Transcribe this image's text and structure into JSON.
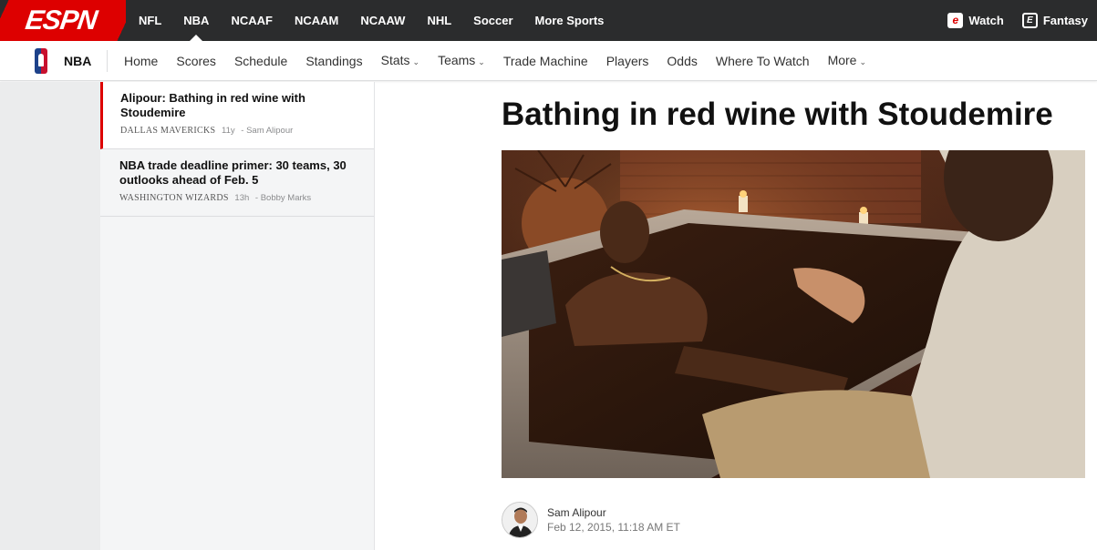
{
  "topbar": {
    "logo": "ESPN",
    "sports": [
      "NFL",
      "NBA",
      "NCAAF",
      "NCAAM",
      "NCAAW",
      "NHL",
      "Soccer",
      "More Sports"
    ],
    "active_sport": "NBA",
    "watch_label": "Watch",
    "fantasy_label": "Fantasy"
  },
  "subnav": {
    "league": "NBA",
    "links": [
      {
        "label": "Home",
        "dropdown": false
      },
      {
        "label": "Scores",
        "dropdown": false
      },
      {
        "label": "Schedule",
        "dropdown": false
      },
      {
        "label": "Standings",
        "dropdown": false
      },
      {
        "label": "Stats",
        "dropdown": true
      },
      {
        "label": "Teams",
        "dropdown": true
      },
      {
        "label": "Trade Machine",
        "dropdown": false
      },
      {
        "label": "Players",
        "dropdown": false
      },
      {
        "label": "Odds",
        "dropdown": false
      },
      {
        "label": "Where To Watch",
        "dropdown": false
      },
      {
        "label": "More",
        "dropdown": true
      }
    ]
  },
  "sidebar": {
    "stories": [
      {
        "headline": "Alipour: Bathing in red wine with Stoudemire",
        "team": "DALLAS MAVERICKS",
        "time": "11y",
        "author": "- Sam Alipour"
      },
      {
        "headline": "NBA trade deadline primer: 30 teams, 30 outlooks ahead of Feb. 5",
        "team": "WASHINGTON WIZARDS",
        "time": "13h",
        "author": "- Bobby Marks"
      }
    ]
  },
  "article": {
    "headline": "Bathing in red wine with Stoudemire",
    "author": "Sam Alipour",
    "date": "Feb 12, 2015, 11:18 AM ET"
  },
  "colors": {
    "brand_red": "#dd0000",
    "topbar_bg": "#2b2c2d"
  }
}
